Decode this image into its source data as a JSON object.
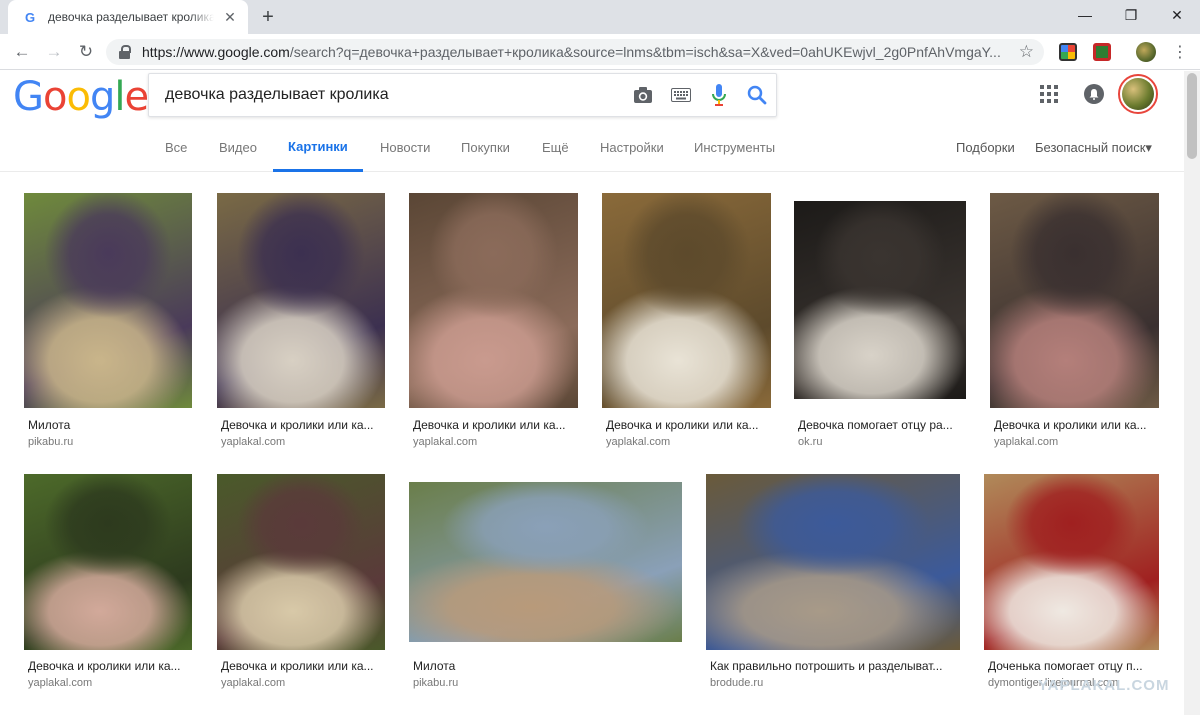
{
  "browser": {
    "tab_title": "девочка разделывает кролика - Поиск в Google",
    "url_host": "https://www.google.com",
    "url_path": "/search?q=девочка+разделывает+кролика&source=lnms&tbm=isch&sa=X&ved=0ahUKEwjvl_2g0PnfAhVmgaY...",
    "new_tab": "+",
    "close": "✕",
    "minimize": "—",
    "maximize": "❐",
    "window_close": "✕",
    "back": "←",
    "forward": "→",
    "reload": "↻",
    "bookmark": "☆",
    "menu": "⋮"
  },
  "google": {
    "logo": [
      "G",
      "o",
      "o",
      "g",
      "l",
      "e"
    ],
    "logo_colors": [
      "#4285f4",
      "#ea4335",
      "#fbbc05",
      "#4285f4",
      "#34a853",
      "#ea4335"
    ],
    "query": "девочка разделывает кролика"
  },
  "tabs": {
    "all": "Все",
    "video": "Видео",
    "images": "Картинки",
    "news": "Новости",
    "shopping": "Покупки",
    "more": "Ещё",
    "settings": "Настройки",
    "tools": "Инструменты",
    "collections": "Подборки",
    "safesearch": "Безопасный поиск▾"
  },
  "results": [
    {
      "caption": "Милота",
      "source": "pikabu.ru",
      "palette": [
        "#6f8a3c",
        "#c9b58a",
        "#4a3a5a"
      ]
    },
    {
      "caption": "Девочка и кролики или ка...",
      "source": "yaplakal.com",
      "palette": [
        "#7a6a45",
        "#d8d0c3",
        "#3c3050"
      ]
    },
    {
      "caption": "Девочка и кролики или ка...",
      "source": "yaplakal.com",
      "palette": [
        "#5a4635",
        "#c99a8e",
        "#8b6b5a"
      ]
    },
    {
      "caption": "Девочка и кролики или ка...",
      "source": "yaplakal.com",
      "palette": [
        "#8a6a3a",
        "#e9e3d6",
        "#5d4a2c"
      ]
    },
    {
      "caption": "Девочка помогает отцу ра...",
      "source": "ok.ru",
      "palette": [
        "#1c1a18",
        "#d8d2c8",
        "#3a3430"
      ]
    },
    {
      "caption": "Девочка и кролики или ка...",
      "source": "yaplakal.com",
      "palette": [
        "#6d5a45",
        "#b47f7a",
        "#3a3030"
      ]
    },
    {
      "caption": "Девочка и кролики или ка...",
      "source": "yaplakal.com",
      "palette": [
        "#4d6a2a",
        "#d2a99a",
        "#2d3a1e"
      ]
    },
    {
      "caption": "Девочка и кролики или ка...",
      "source": "yaplakal.com",
      "palette": [
        "#4a5a2a",
        "#d8c9a8",
        "#5a3a3a"
      ]
    },
    {
      "caption": "Милота",
      "source": "pikabu.ru",
      "palette": [
        "#6a7e4a",
        "#b89a7a",
        "#8aa0b8"
      ]
    },
    {
      "caption": "Как правильно потрошить и разделыват...",
      "source": "brodude.ru",
      "palette": [
        "#6a5a3a",
        "#a89a88",
        "#3c5a9a"
      ]
    },
    {
      "caption": "Доченька помогает отцу п...",
      "source": "dymontiger.livejournal.com",
      "palette": [
        "#b08a5a",
        "#efe9e2",
        "#a02020"
      ]
    }
  ],
  "watermark": "YAPLAKAL.COM"
}
